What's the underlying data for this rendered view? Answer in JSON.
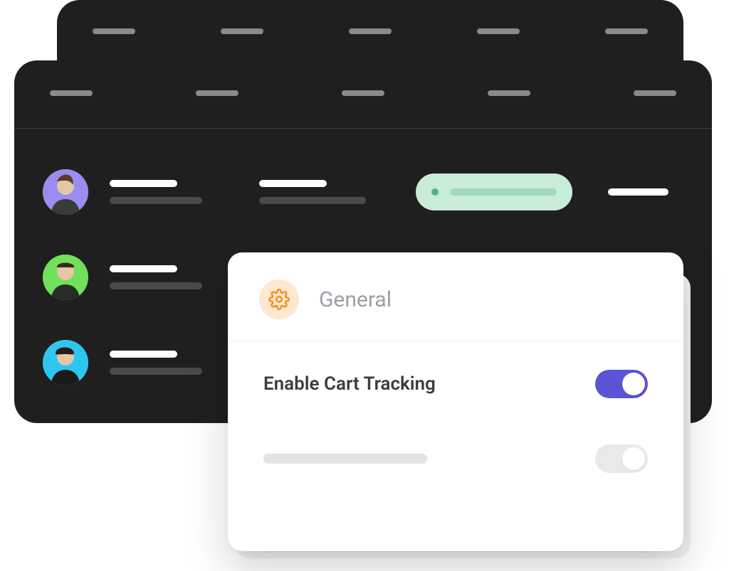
{
  "avatars": [
    {
      "bg": "#9b8cf0"
    },
    {
      "bg": "#71e05a"
    },
    {
      "bg": "#2ec6f0"
    }
  ],
  "settings_card": {
    "heading": "General",
    "items": [
      {
        "label": "Enable Cart Tracking",
        "enabled": true
      },
      {
        "label": "",
        "enabled": false
      }
    ]
  },
  "colors": {
    "accent": "#5b54d6",
    "mint": "#c9ecd8",
    "gear": "#f5901d"
  }
}
